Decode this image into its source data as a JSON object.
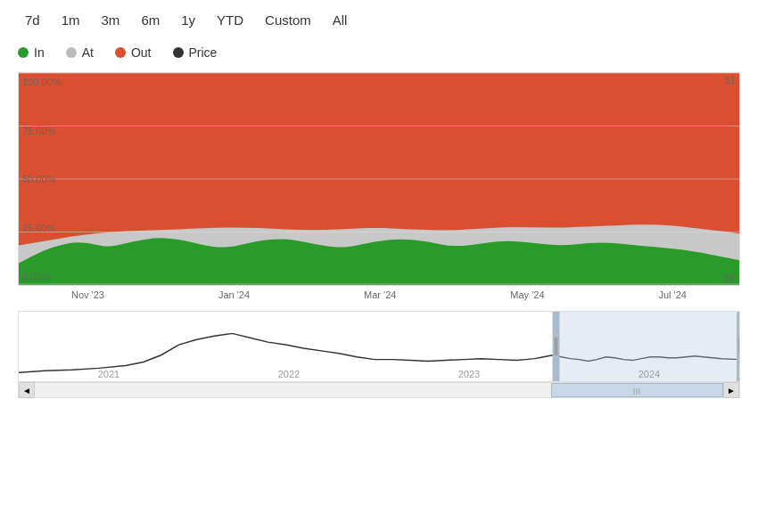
{
  "timeButtons": [
    "7d",
    "1m",
    "3m",
    "6m",
    "1y",
    "YTD",
    "Custom",
    "All"
  ],
  "legend": [
    {
      "label": "In",
      "color": "#2a9a2a"
    },
    {
      "label": "At",
      "color": "#bbbbbb"
    },
    {
      "label": "Out",
      "color": "#d94f30"
    },
    {
      "label": "Price",
      "color": "#333333"
    }
  ],
  "yLabels": [
    "100.00%",
    "75.00%",
    "50.00%",
    "25.00%",
    "0.00%"
  ],
  "dollarTop": "$1",
  "dollarBottom": "$0",
  "xLabels": [
    "Nov '23",
    "Jan '24",
    "Mar '24",
    "May '24",
    "Jul '24"
  ],
  "miniXLabels": [
    "2021",
    "2022",
    "2023",
    "2024"
  ],
  "scrollLeft": "◄",
  "scrollRight": "►",
  "scrollGrip": "|||"
}
